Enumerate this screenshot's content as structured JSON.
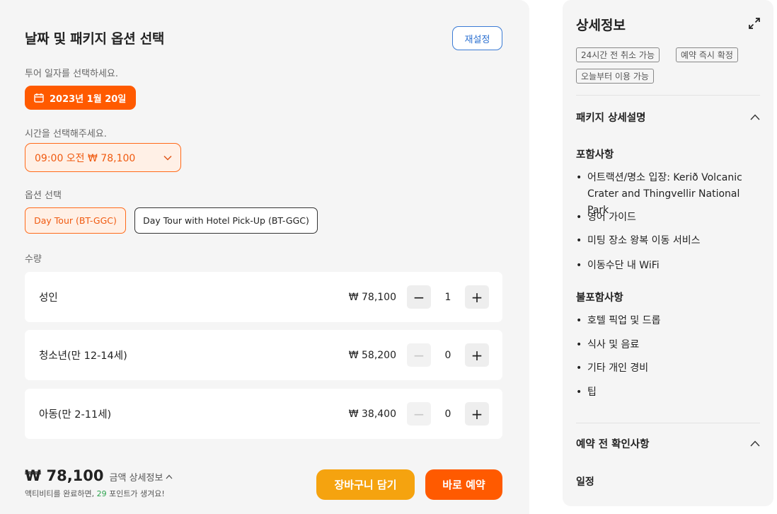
{
  "left": {
    "title": "날짜 및 패키지 옵션 선택",
    "reset_label": "재설정",
    "date_prompt": "투어 일자를 선택하세요.",
    "date_value": "2023년 1월 20일",
    "time_prompt": "시간을 선택해주세요.",
    "time_value": "09:00 오전 ₩ 78,100",
    "option_prompt": "옵션 선택",
    "options": [
      {
        "label": "Day Tour (BT-GGC)",
        "selected": true
      },
      {
        "label": "Day Tour with Hotel Pick-Up (BT-GGC)",
        "selected": false
      }
    ],
    "qty_prompt": "수량",
    "quantities": [
      {
        "name": "성인",
        "price": "₩ 78,100",
        "count": "1",
        "minus_enabled": true
      },
      {
        "name": "청소년(만 12-14세)",
        "price": "₩ 58,200",
        "count": "0",
        "minus_enabled": false
      },
      {
        "name": "아동(만 2-11세)",
        "price": "₩ 38,400",
        "count": "0",
        "minus_enabled": false
      }
    ],
    "total": "₩ 78,100",
    "total_detail": "금액 상세정보",
    "points_prefix": "액티비티를 완료하면, ",
    "points_value": "29",
    "points_suffix": " 포인트가 생겨요!",
    "cart_label": "장바구니 담기",
    "book_label": "바로 예약"
  },
  "right": {
    "title": "상세정보",
    "tags": [
      "24시간 전 취소 가능",
      "예약 즉시 확정",
      "오늘부터 이용 가능"
    ],
    "package_section": "패키지 상세설명",
    "included_title": "포함사항",
    "included": [
      "어트랙션/명소 입장: Kerið Volcanic Crater and Thingvellir National Park",
      "영어 가이드",
      "미팅 장소 왕복 이동 서비스",
      "이동수단 내 WiFi"
    ],
    "excluded_title": "불포함사항",
    "excluded": [
      "호텔 픽업 및 드롭",
      "식사 및 음료",
      "기타 개인 경비",
      "팁"
    ],
    "booking_section": "예약 전 확인사항",
    "schedule_label": "일정"
  },
  "colors": {
    "accent": "#ff5a00",
    "cart": "#f5a30f",
    "link": "#2a6fd0",
    "points": "#2ea44f"
  },
  "icons": [
    "calendar-icon",
    "chevron-down-icon",
    "minus-icon",
    "plus-icon",
    "chevron-up-icon",
    "expand-icon"
  ]
}
